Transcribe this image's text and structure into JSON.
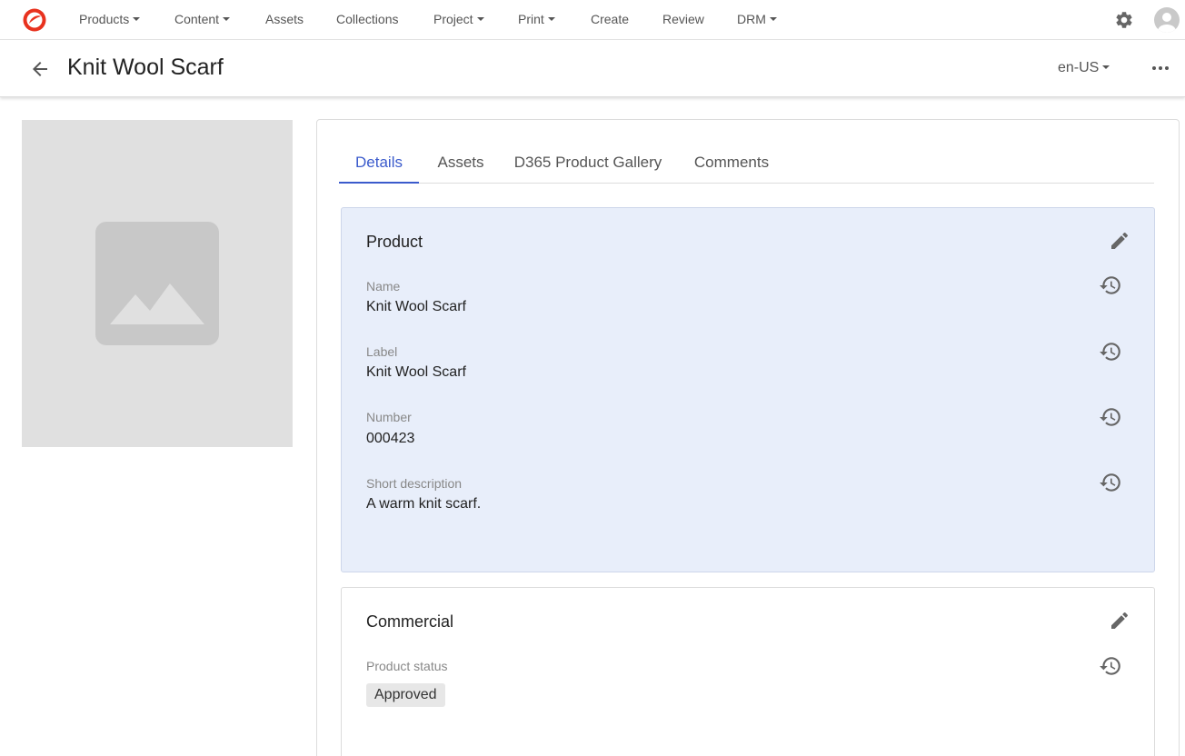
{
  "nav": {
    "items": [
      {
        "label": "Products",
        "dropdown": true
      },
      {
        "label": "Content",
        "dropdown": true
      },
      {
        "label": "Assets",
        "dropdown": false
      },
      {
        "label": "Collections",
        "dropdown": false
      },
      {
        "label": "Project",
        "dropdown": true
      },
      {
        "label": "Print",
        "dropdown": true
      },
      {
        "label": "Create",
        "dropdown": false
      },
      {
        "label": "Review",
        "dropdown": false
      },
      {
        "label": "DRM",
        "dropdown": true
      }
    ],
    "icons": {
      "logo": "brand-logo-icon",
      "settings": "gear-icon",
      "user": "avatar-icon"
    }
  },
  "header": {
    "title": "Knit Wool Scarf",
    "language": "en-US"
  },
  "tabs": [
    "Details",
    "Assets",
    "D365 Product Gallery",
    "Comments"
  ],
  "active_tab": "Details",
  "product_card": {
    "title": "Product",
    "fields": [
      {
        "label": "Name",
        "value": "Knit Wool Scarf"
      },
      {
        "label": "Label",
        "value": "Knit Wool Scarf"
      },
      {
        "label": "Number",
        "value": "000423"
      },
      {
        "label": "Short description",
        "value": "A warm knit scarf."
      }
    ]
  },
  "commercial_card": {
    "title": "Commercial",
    "fields": [
      {
        "label": "Product status",
        "value": "Approved"
      }
    ]
  },
  "colors": {
    "accent": "#3b5bcc",
    "logo": "#e8321e",
    "product_card_bg": "#e8eefa"
  }
}
